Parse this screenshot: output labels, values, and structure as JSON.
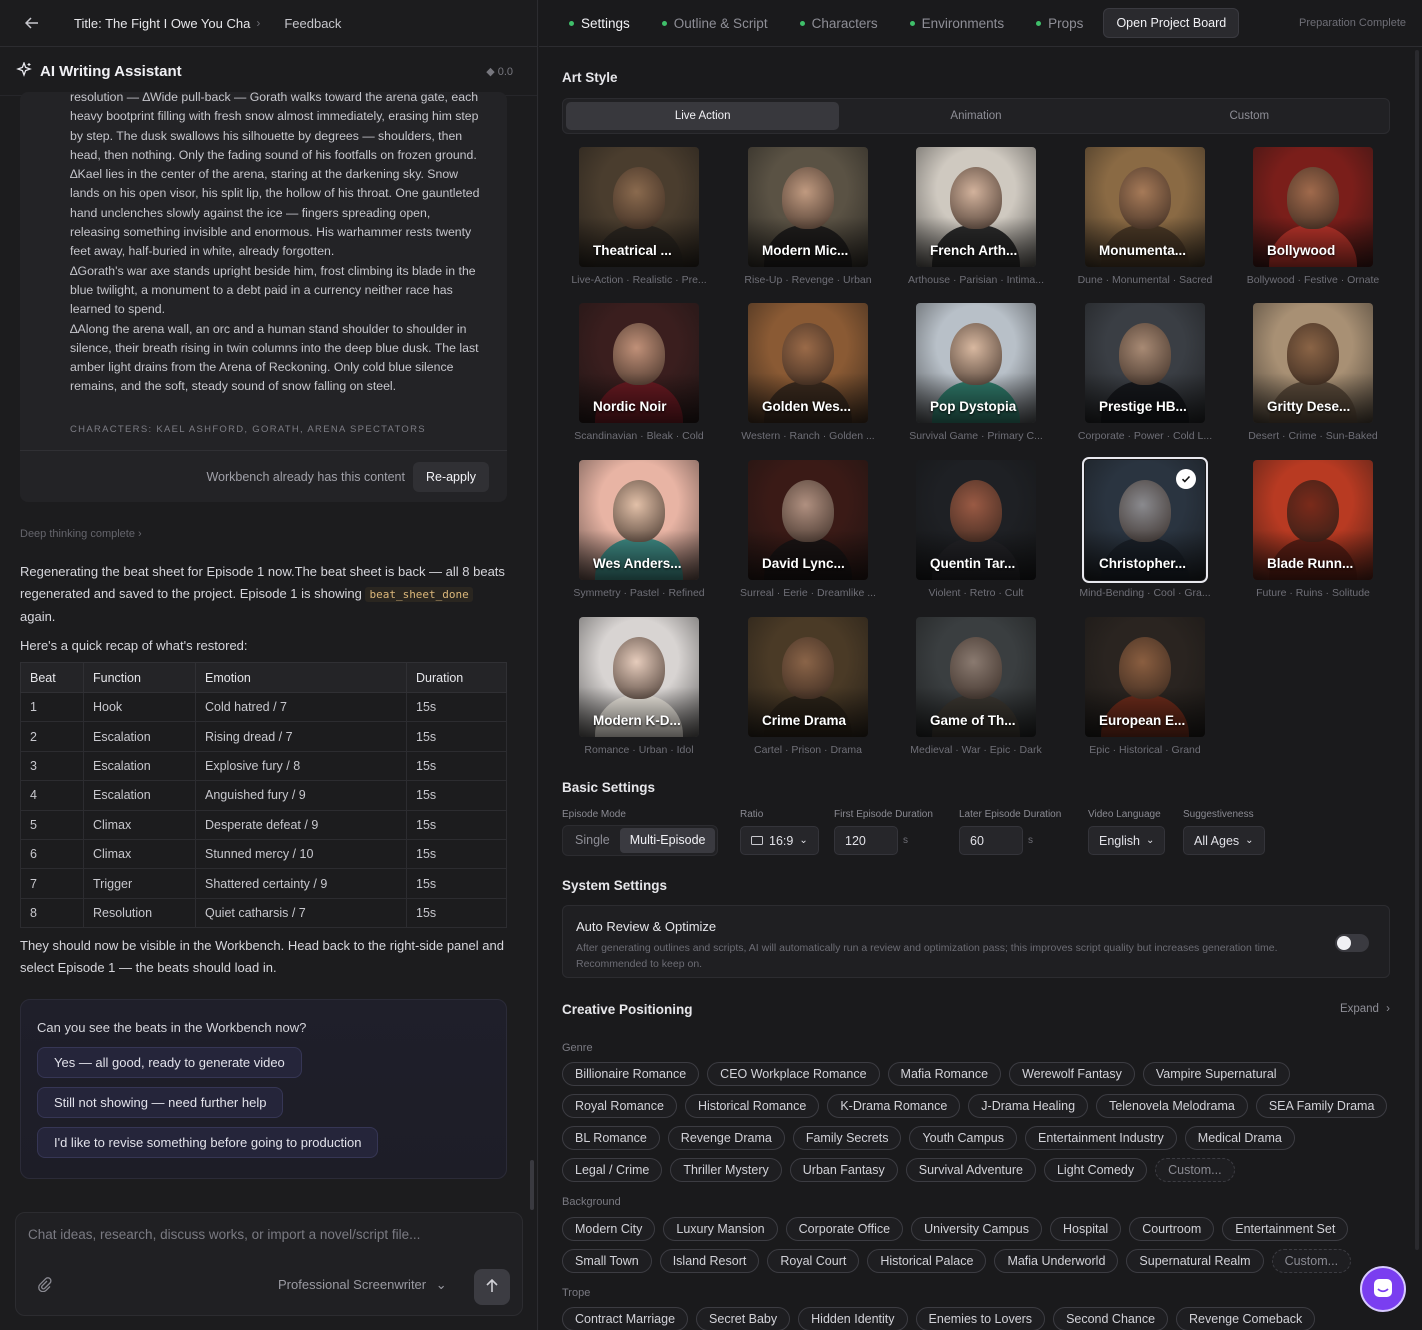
{
  "header": {
    "back_icon": "arrow-left-icon",
    "title": "Title: The Fight I Owe You Cha",
    "separator": "›",
    "feedback": "Feedback"
  },
  "assistant": {
    "title": "AI Writing Assistant",
    "credits": "0.0",
    "script_paragraphs": [
      "resolution — ∆Wide pull-back — Gorath walks toward the arena gate, each heavy bootprint filling with fresh snow almost immediately, erasing him step by step. The dusk swallows his silhouette by degrees — shoulders, then head, then nothing. Only the fading sound of his footfalls on frozen ground.",
      "∆Kael lies in the center of the arena, staring at the darkening sky. Snow lands on his open visor, his split lip, the hollow of his throat. One gauntleted hand unclenches slowly against the ice — fingers spreading open, releasing something invisible and enormous. His warhammer rests twenty feet away, half-buried in white, already forgotten.",
      "∆Gorath's war axe stands upright beside him, frost climbing its blade in the blue twilight, a monument to a debt paid in a currency neither race has learned to spend.",
      "∆Along the arena wall, an orc and a human stand shoulder to shoulder in silence, their breath rising in twin columns into the deep blue dusk. The last amber light drains from the Arena of Reckoning. Only cold blue silence remains, and the soft, steady sound of snow falling on steel."
    ],
    "characters_line": "CHARACTERS: KAEL ASHFORD, GORATH, ARENA SPECTATORS",
    "workbench_note": "Workbench already has this content",
    "reapply": "Re-apply",
    "thinking": "Deep thinking complete",
    "msg1_a": "Regenerating the beat sheet for Episode 1 now.The beat sheet is back — all 8 beats regenerated and saved to the project. Episode 1 is showing ",
    "msg1_code": "beat_sheet_done",
    "msg1_b": " again.",
    "recap": "Here's a quick recap of what's restored:",
    "table": {
      "headers": [
        "Beat",
        "Function",
        "Emotion",
        "Duration"
      ],
      "rows": [
        [
          "1",
          "Hook",
          "Cold hatred / 7",
          "15s"
        ],
        [
          "2",
          "Escalation",
          "Rising dread / 7",
          "15s"
        ],
        [
          "3",
          "Escalation",
          "Explosive fury / 8",
          "15s"
        ],
        [
          "4",
          "Escalation",
          "Anguished fury / 9",
          "15s"
        ],
        [
          "5",
          "Climax",
          "Desperate defeat / 9",
          "15s"
        ],
        [
          "6",
          "Climax",
          "Stunned mercy / 10",
          "15s"
        ],
        [
          "7",
          "Trigger",
          "Shattered certainty / 9",
          "15s"
        ],
        [
          "8",
          "Resolution",
          "Quiet catharsis / 7",
          "15s"
        ]
      ]
    },
    "msg2": "They should now be visible in the Workbench. Head back to the right-side panel and select Episode 1 — the beats should load in.",
    "question": "Can you see the beats in the Workbench now?",
    "options": [
      "Yes — all good, ready to generate video",
      "Still not showing — need further help",
      "I'd like to revise something before going to production"
    ],
    "composer_placeholder": "Chat ideas, research, discuss works, or import a novel/script file...",
    "persona": "Professional Screenwriter"
  },
  "tabs": {
    "items": [
      "Settings",
      "Outline & Script",
      "Characters",
      "Environments",
      "Props"
    ],
    "active": "Settings",
    "board_button": "Open Project Board",
    "status": "Preparation Complete"
  },
  "art_style": {
    "title": "Art Style",
    "style_tabs": [
      "Live Action",
      "Animation",
      "Custom"
    ],
    "active_tab": "Live Action",
    "cards": [
      {
        "name": "Theatrical ...",
        "tags": "Live-Action · Realistic · Pre...",
        "bg": "#4a3d2e",
        "skin": "#8a6a4e",
        "cloth": "#2b2620"
      },
      {
        "name": "Modern Mic...",
        "tags": "Rise-Up · Revenge · Urban",
        "bg": "#5a5244",
        "skin": "#c09a80",
        "cloth": "#1f1d1c"
      },
      {
        "name": "French Arth...",
        "tags": "Arthouse · Parisian · Intima...",
        "bg": "#cfc9c0",
        "skin": "#d2b29c",
        "cloth": "#2a2a2a"
      },
      {
        "name": "Monumenta...",
        "tags": "Dune · Monumental · Sacred",
        "bg": "#8a6a44",
        "skin": "#a67a58",
        "cloth": "#4a3826"
      },
      {
        "name": "Bollywood",
        "tags": "Bollywood · Festive · Ornate",
        "bg": "#7a1e1a",
        "skin": "#a06a4c",
        "cloth": "#b8332a"
      },
      {
        "name": "Nordic Noir",
        "tags": "Scandinavian · Bleak · Cold",
        "bg": "#3a1e1e",
        "skin": "#c09078",
        "cloth": "#6a1a22"
      },
      {
        "name": "Golden Wes...",
        "tags": "Western · Ranch · Golden ...",
        "bg": "#8a5a34",
        "skin": "#9a6a48",
        "cloth": "#3a2a1e"
      },
      {
        "name": "Pop Dystopia",
        "tags": "Survival Game · Primary C...",
        "bg": "#b8c0c8",
        "skin": "#d8b8a0",
        "cloth": "#2f7a6a"
      },
      {
        "name": "Prestige HB...",
        "tags": "Corporate · Power · Cold L...",
        "bg": "#3a3e44",
        "skin": "#a88a74",
        "cloth": "#16181c"
      },
      {
        "name": "Gritty Dese...",
        "tags": "Desert · Crime · Sun-Baked",
        "bg": "#a89074",
        "skin": "#8a6446",
        "cloth": "#5a4a3a"
      },
      {
        "name": "Wes Anders...",
        "tags": "Symmetry · Pastel · Refined",
        "bg": "#e8b4a4",
        "skin": "#e2c0a8",
        "cloth": "#3e8a84"
      },
      {
        "name": "David Lync...",
        "tags": "Surreal · Eerie · Dreamlike ...",
        "bg": "#3a1a16",
        "skin": "#b09080",
        "cloth": "#1a1414"
      },
      {
        "name": "Quentin Tar...",
        "tags": "Violent · Retro · Cult",
        "bg": "#1e2024",
        "skin": "#9a5a44",
        "cloth": "#222226"
      },
      {
        "name": "Christopher...",
        "tags": "Mind-Bending · Cool · Gra...",
        "bg": "#2a3440",
        "skin": "#8a8a8e",
        "cloth": "#1a2028",
        "selected": true
      },
      {
        "name": "Blade Runn...",
        "tags": "Future · Ruins · Solitude",
        "bg": "#b83a22",
        "skin": "#7a2a1a",
        "cloth": "#5a1e14"
      },
      {
        "name": "Modern K-D...",
        "tags": "Romance · Urban · Idol",
        "bg": "#d8d4d2",
        "skin": "#e6ccbc",
        "cloth": "#ebe6de"
      },
      {
        "name": "Crime Drama",
        "tags": "Cartel · Prison · Drama",
        "bg": "#4a3a26",
        "skin": "#8a6448",
        "cloth": "#2a2218"
      },
      {
        "name": "Game of Th...",
        "tags": "Medieval · War · Epic · Dark",
        "bg": "#3a3e40",
        "skin": "#8a7a70",
        "cloth": "#3a3630"
      },
      {
        "name": "European E...",
        "tags": "Epic · Historical · Grand",
        "bg": "#2a2420",
        "skin": "#8a5e40",
        "cloth": "#6a2a1a"
      }
    ]
  },
  "basic": {
    "title": "Basic Settings",
    "episode_mode_label": "Episode Mode",
    "episode_modes": [
      "Single",
      "Multi-Episode"
    ],
    "episode_mode_active": "Multi-Episode",
    "ratio_label": "Ratio",
    "ratio": "16:9",
    "first_dur_label": "First Episode Duration",
    "first_dur": "120",
    "later_dur_label": "Later Episode Duration",
    "later_dur": "60",
    "unit": "s",
    "lang_label": "Video Language",
    "lang": "English",
    "sugg_label": "Suggestiveness",
    "sugg": "All Ages"
  },
  "system": {
    "title": "System Settings",
    "auto_title": "Auto Review & Optimize",
    "auto_desc": "After generating outlines and scripts, AI will automatically run a review and optimization pass; this improves script quality but increases generation time. Recommended to keep on.",
    "auto_on": false
  },
  "creative": {
    "title": "Creative Positioning",
    "expand": "Expand",
    "genre_label": "Genre",
    "genres": [
      "Billionaire Romance",
      "CEO Workplace Romance",
      "Mafia Romance",
      "Werewolf Fantasy",
      "Vampire Supernatural",
      "Royal Romance",
      "Historical Romance",
      "K-Drama Romance",
      "J-Drama Healing",
      "Telenovela Melodrama",
      "SEA Family Drama",
      "BL Romance",
      "Revenge Drama",
      "Family Secrets",
      "Youth Campus",
      "Entertainment Industry",
      "Medical Drama",
      "Legal / Crime",
      "Thriller Mystery",
      "Urban Fantasy",
      "Survival Adventure",
      "Light Comedy"
    ],
    "custom": "Custom...",
    "background_label": "Background",
    "backgrounds": [
      "Modern City",
      "Luxury Mansion",
      "Corporate Office",
      "University Campus",
      "Hospital",
      "Courtroom",
      "Entertainment Set",
      "Small Town",
      "Island Resort",
      "Royal Court",
      "Historical Palace",
      "Mafia Underworld",
      "Supernatural Realm"
    ],
    "trope_label": "Trope",
    "tropes": [
      "Contract Marriage",
      "Secret Baby",
      "Hidden Identity",
      "Enemies to Lovers",
      "Second Chance",
      "Revenge Comeback"
    ]
  }
}
